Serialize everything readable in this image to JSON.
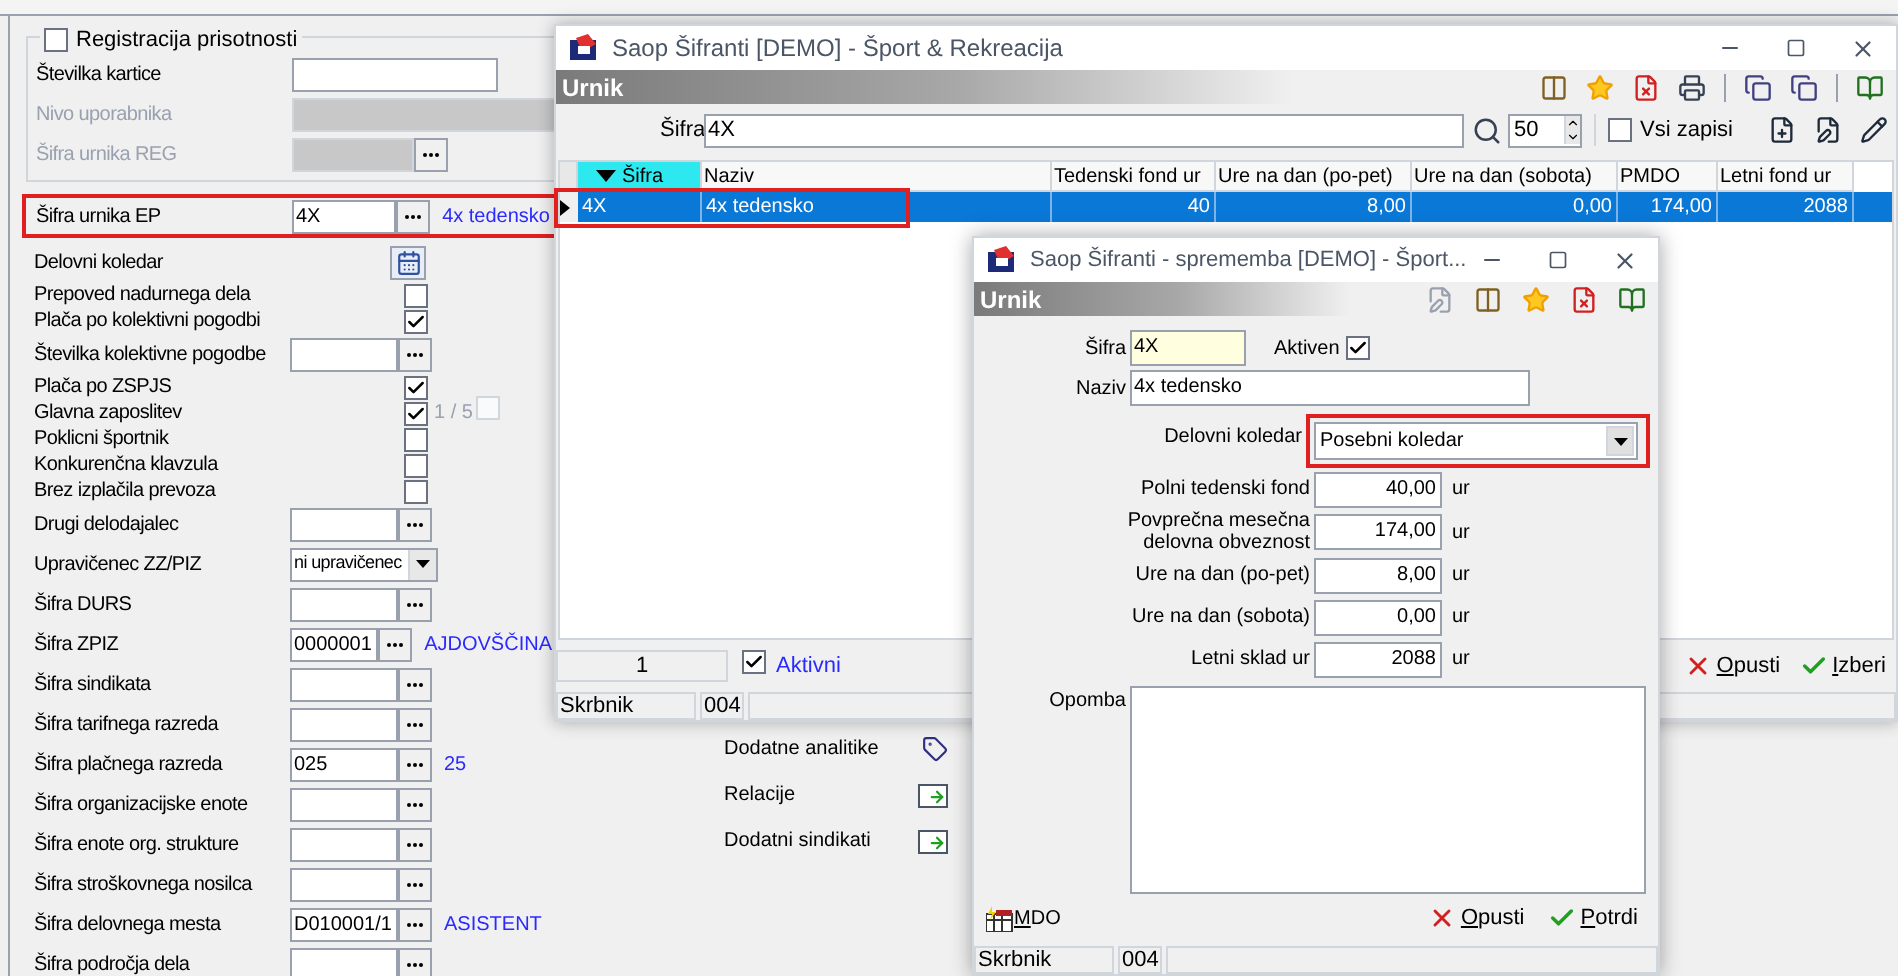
{
  "left_form": {
    "group": {
      "label": "Registracija prisotnosti",
      "checked": false,
      "rows": [
        {
          "kind": "text",
          "label": "Številka kartice"
        },
        {
          "kind": "disabled",
          "label": "Nivo uporabnika"
        },
        {
          "kind": "disabled_lookup",
          "label": "Šifra urnika REG"
        }
      ]
    },
    "rows": [
      {
        "kind": "lookup",
        "label": "Šifra urnika EP",
        "value": "4X",
        "description": "4x tedensko",
        "highlighted": true
      },
      {
        "kind": "calendar",
        "label": "Delovni koledar"
      },
      {
        "kind": "check",
        "label": "Prepoved nadurnega dela",
        "checked": false
      },
      {
        "kind": "check",
        "label": "Plača po kolektivni pogodbi",
        "checked": true
      },
      {
        "kind": "lookup",
        "label": "Številka kolektivne pogodbe"
      },
      {
        "kind": "check",
        "label": "Plača po ZSPJS",
        "checked": true
      },
      {
        "kind": "check",
        "label": "Glavna zaposlitev",
        "checked": true,
        "extra": "1 / 5",
        "extra_checked": false
      },
      {
        "kind": "check",
        "label": "Poklicni športnik",
        "checked": false
      },
      {
        "kind": "check",
        "label": "Konkurenčna klavzula",
        "checked": false
      },
      {
        "kind": "check",
        "label": "Brez izplačila prevoza",
        "checked": false
      },
      {
        "kind": "lookup",
        "label": "Drugi delodajalec"
      },
      {
        "kind": "select",
        "label": "Upravičenec ZZ/PIZ",
        "value": "ni upravičenec"
      },
      {
        "kind": "lookup",
        "label": "Šifra DURS"
      },
      {
        "kind": "lookup",
        "label": "Šifra ZPIZ",
        "value": "0000001",
        "description": "AJDOVŠČINA"
      },
      {
        "kind": "lookup",
        "label": "Šifra sindikata"
      },
      {
        "kind": "lookup",
        "label": "Šifra tarifnega razreda"
      },
      {
        "kind": "lookup",
        "label": "Šifra plačnega razreda",
        "value": "025",
        "description": "25"
      },
      {
        "kind": "lookup",
        "label": "Šifra organizacijske enote"
      },
      {
        "kind": "lookup",
        "label": "Šifra enote org. strukture"
      },
      {
        "kind": "lookup",
        "label": "Šifra stroškovnega nosilca"
      },
      {
        "kind": "lookup",
        "label": "Šifra delovnega mesta",
        "value": "D010001/1",
        "description": "ASISTENT"
      },
      {
        "kind": "lookup",
        "label": "Šifra področja dela"
      }
    ]
  },
  "links": [
    {
      "label": "Dodatne analitike",
      "kind": "analytics"
    },
    {
      "label": "Relacije",
      "kind": "relations"
    },
    {
      "label": "Dodatni sindikati",
      "kind": "relations"
    }
  ],
  "list_window": {
    "title": "Saop Šifranti [DEMO] - Šport & Rekreacija",
    "section": "Urnik",
    "filter": {
      "label": "Šifra",
      "value": "4X",
      "count": "50"
    },
    "show_all": {
      "label": "Vsi zapisi",
      "checked": false
    },
    "columns": [
      {
        "label": "Šifra",
        "sorted": true
      },
      {
        "label": "Naziv",
        "sorted": false
      },
      {
        "label": "Tedenski fond ur",
        "sorted": false
      },
      {
        "label": "Ure na dan (po-pet)",
        "sorted": false
      },
      {
        "label": "Ure na dan (sobota)",
        "sorted": false
      },
      {
        "label": "PMDO",
        "sorted": false
      },
      {
        "label": "Letni fond ur",
        "sorted": false
      }
    ],
    "rows": [
      {
        "selected": true,
        "highlighted": true,
        "cells": [
          "4X",
          "4x tedensko",
          "40",
          "8,00",
          "0,00",
          "174,00",
          "2088"
        ]
      }
    ],
    "footer": {
      "count": "1",
      "active": {
        "label": "Aktivni",
        "checked": true
      },
      "buttons": [
        {
          "label": "Opusti",
          "kind": "cancel"
        },
        {
          "label": "Izberi",
          "kind": "ok"
        }
      ]
    },
    "status": [
      "Skrbnik",
      "004"
    ]
  },
  "edit_dialog": {
    "title": "Saop Šifranti - sprememba [DEMO] - Šport...",
    "section": "Urnik",
    "code": {
      "label": "Šifra",
      "value": "4X"
    },
    "active": {
      "label": "Aktiven",
      "checked": true
    },
    "name": {
      "label": "Naziv",
      "value": "4x tedensko"
    },
    "calendar": {
      "label": "Delovni koledar",
      "value": "Posebni koledar",
      "highlighted": true
    },
    "numbers": [
      {
        "label": "Polni tedenski fond",
        "value": "40,00",
        "unit": "ur"
      },
      {
        "label": "Povprečna mesečna delovna obveznost",
        "value": "174,00",
        "unit": "ur"
      },
      {
        "label": "Ure na dan (po-pet)",
        "value": "8,00",
        "unit": "ur"
      },
      {
        "label": "Ure na dan (sobota)",
        "value": "0,00",
        "unit": "ur"
      },
      {
        "label": "Letni sklad ur",
        "value": "2088",
        "unit": "ur"
      }
    ],
    "note": {
      "label": "Opomba"
    },
    "mdo": "MDO",
    "buttons": [
      {
        "label": "Opusti",
        "kind": "cancel"
      },
      {
        "label": "Potrdi",
        "kind": "ok"
      }
    ],
    "status": [
      "Skrbnik",
      "004"
    ]
  }
}
